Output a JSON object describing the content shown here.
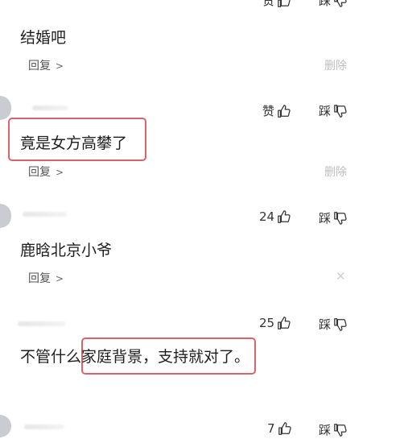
{
  "top_actions": {
    "like": "赞",
    "dislike": "踩"
  },
  "comments": [
    {
      "text": "结婚吧",
      "reply": "回复",
      "delete": "删除"
    },
    {
      "text": "竟是女方高攀了",
      "reply": "回复",
      "delete": "删除",
      "like": "赞",
      "dislike": "踩"
    },
    {
      "text": "鹿晗北京小爷",
      "reply": "回复",
      "like": "24",
      "dislike": "踩"
    },
    {
      "text_plain": "不管什么",
      "text_highlight": "家庭背景，支持就对了。",
      "like": "25",
      "dislike": "踩"
    },
    {
      "like": "7",
      "dislike": "踩"
    }
  ],
  "colors": {
    "highlight_border": "#d9636b",
    "muted": "#bdbdbd"
  },
  "icons": {
    "like": "thumbs-up-icon",
    "dislike": "thumbs-down-icon",
    "reply_arrow": "chevron-right-icon",
    "close": "close-icon"
  }
}
